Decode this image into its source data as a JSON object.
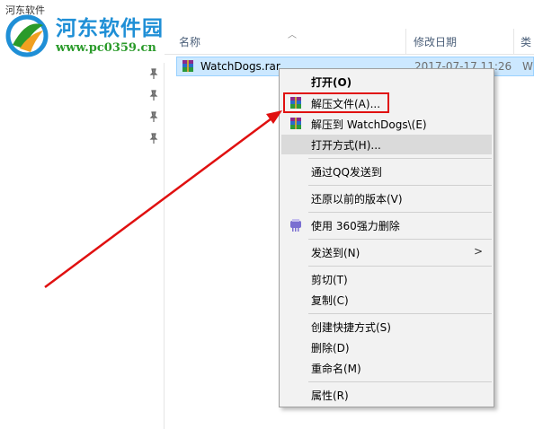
{
  "window": {
    "breadcrumb": "河东软件"
  },
  "watermark": {
    "title": "河东软件园",
    "url": "www.pc0359.cn"
  },
  "columns": {
    "name": "名称",
    "date": "修改日期",
    "type": "类"
  },
  "file": {
    "name": "WatchDogs.rar",
    "date": "2017-07-17 11:26",
    "type": "W"
  },
  "menu": {
    "open": "打开(O)",
    "extract_files": "解压文件(A)...",
    "extract_to": "解压到 WatchDogs\\(E)",
    "open_with": "打开方式(H)...",
    "send_qq": "通过QQ发送到",
    "restore": "还原以前的版本(V)",
    "delete_360": "使用 360强力删除",
    "send_to": "发送到(N)",
    "cut": "剪切(T)",
    "copy": "复制(C)",
    "create_shortcut": "创建快捷方式(S)",
    "delete": "删除(D)",
    "rename": "重命名(M)",
    "properties": "属性(R)"
  },
  "colors": {
    "selection": "#cce8ff",
    "annotation_red": "#e01010",
    "watermark_blue": "#1f8fd6",
    "watermark_green": "#2a9a2a"
  }
}
